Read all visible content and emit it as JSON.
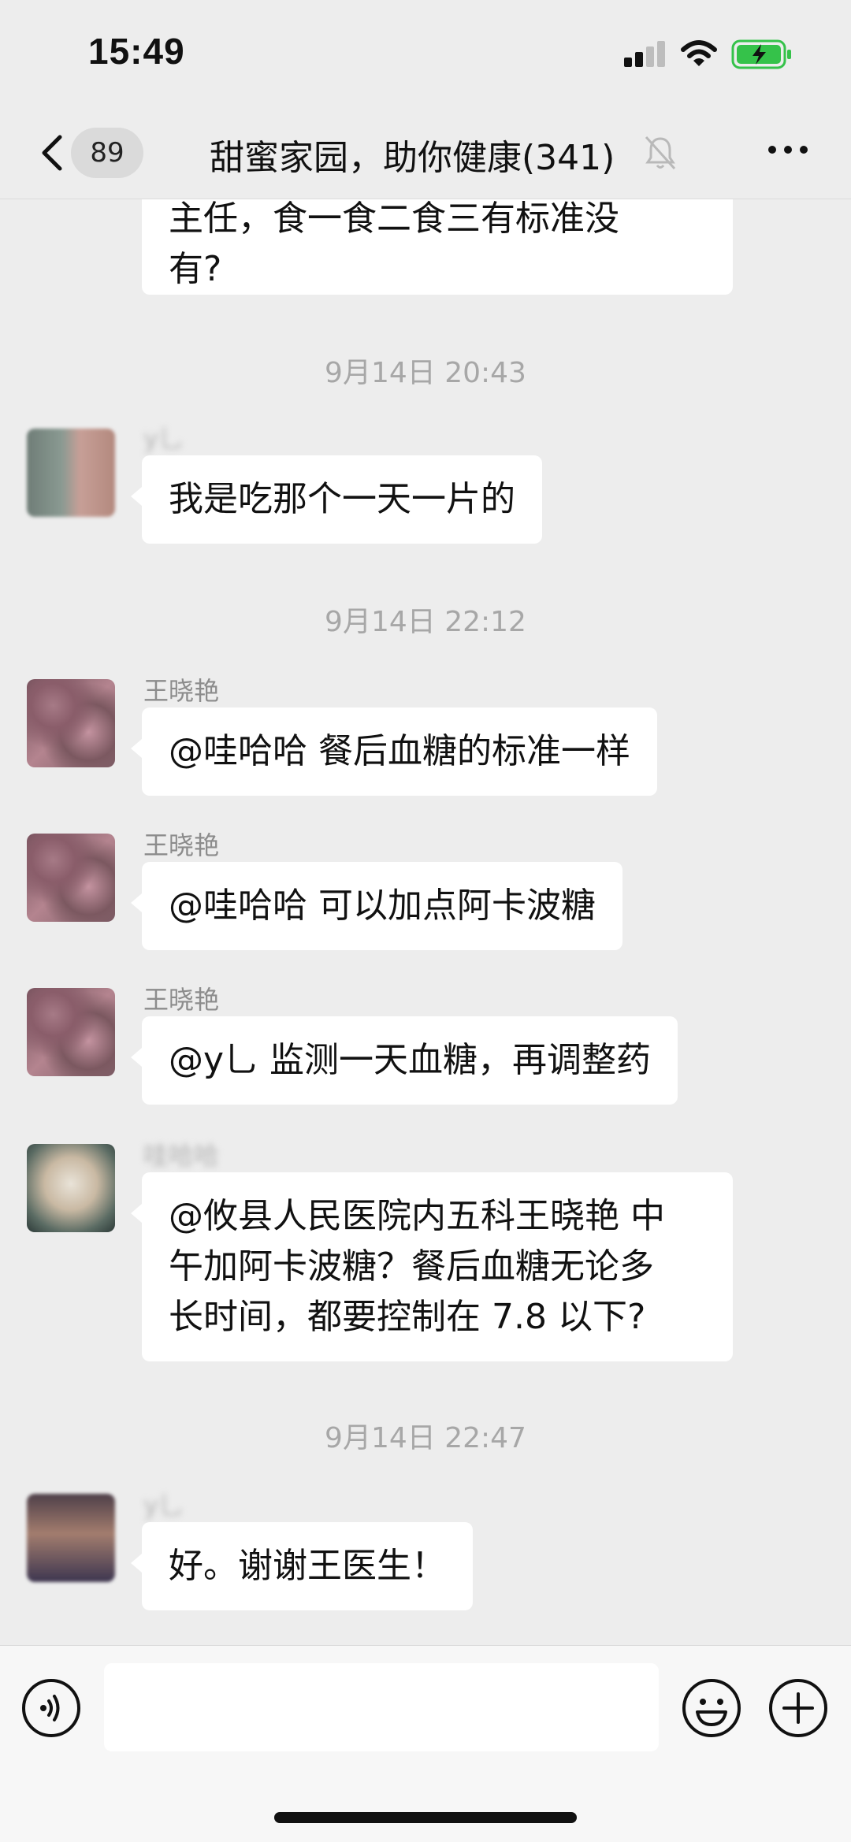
{
  "status": {
    "time": "15:49"
  },
  "header": {
    "unread_count": "89",
    "title": "甜蜜家园，助你健康(341)"
  },
  "messages": [
    {
      "kind": "text",
      "lines": [
        "主任，食一食二食三有标准没",
        "有?"
      ]
    },
    {
      "kind": "timestamp",
      "text": "9月14日 20:43"
    },
    {
      "kind": "text",
      "sender": "y乚",
      "lines": [
        "我是吃那个一天一片的"
      ]
    },
    {
      "kind": "timestamp",
      "text": "9月14日 22:12"
    },
    {
      "kind": "text",
      "sender": "王晓艳",
      "lines": [
        "@哇哈哈 餐后血糖的标准一样"
      ]
    },
    {
      "kind": "text",
      "sender": "王晓艳",
      "lines": [
        "@哇哈哈 可以加点阿卡波糖"
      ]
    },
    {
      "kind": "text",
      "sender": "王晓艳",
      "lines": [
        "@y乚 监测一天血糖，再调整药"
      ]
    },
    {
      "kind": "text",
      "sender": "哇哈哈",
      "lines": [
        "@攸县人民医院内五科王晓艳 中",
        "午加阿卡波糖？餐后血糖无论多",
        "长时间，都要控制在 7.8 以下?"
      ]
    },
    {
      "kind": "timestamp",
      "text": "9月14日 22:47"
    },
    {
      "kind": "text",
      "sender": "y乚",
      "lines": [
        "好。谢谢王医生！"
      ]
    }
  ],
  "colors": {
    "bubble": "#ffffff",
    "background": "#ededed",
    "battery": "#35c24a"
  },
  "icons": [
    "back-icon",
    "mute-icon",
    "more-icon",
    "voice-icon",
    "emoji-icon",
    "plus-icon"
  ]
}
